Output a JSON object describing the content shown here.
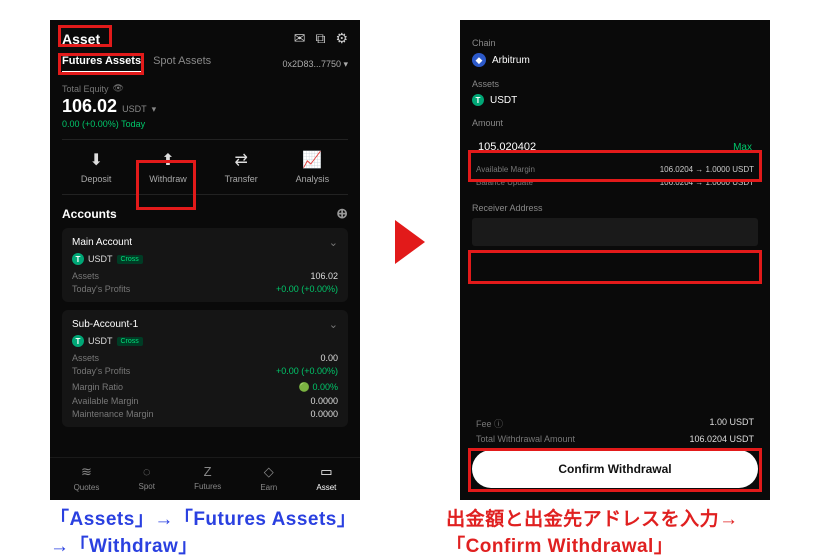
{
  "phone1": {
    "header_title": "Asset",
    "tabs": {
      "futures": "Futures Assets",
      "spot": "Spot Assets"
    },
    "address": "0x2D83...7750 ▾",
    "equity": {
      "label": "Total Equity",
      "value": "106.02",
      "currency": "USDT",
      "today": "0.00 (+0.00%) Today"
    },
    "actions": {
      "deposit": "Deposit",
      "withdraw": "Withdraw",
      "transfer": "Transfer",
      "analysis": "Analysis"
    },
    "accounts_label": "Accounts",
    "main_account": {
      "title": "Main Account",
      "coin": "USDT",
      "mode": "Cross",
      "assets_label": "Assets",
      "assets_value": "106.02",
      "profits_label": "Today's Profits",
      "profits_value": "+0.00  (+0.00%)"
    },
    "sub_account": {
      "title": "Sub-Account-1",
      "coin": "USDT",
      "mode": "Cross",
      "assets_label": "Assets",
      "assets_value": "0.00",
      "profits_label": "Today's Profits",
      "profits_value": "+0.00  (+0.00%)",
      "margin_ratio_label": "Margin Ratio",
      "margin_ratio_value": "0.00%",
      "avail_label": "Available Margin",
      "avail_value": "0.0000",
      "maint_label": "Maintenance Margin",
      "maint_value": "0.0000"
    },
    "nav": {
      "quotes": "Quotes",
      "spot": "Spot",
      "futures": "Futures",
      "earn": "Earn",
      "asset": "Asset"
    }
  },
  "phone2": {
    "chain_label": "Chain",
    "chain_value": "Arbitrum",
    "assets_label": "Assets",
    "assets_value": "USDT",
    "amount_label": "Amount",
    "amount_value": "105.020402",
    "max": "Max",
    "avail_margin_label": "Available Margin",
    "avail_margin_value": "106.0204 → 1.0000 USDT",
    "balance_label": "Balance Update",
    "balance_value": "106.0204 → 1.0000 USDT",
    "receiver_label": "Receiver Address",
    "fee_label": "Fee",
    "fee_value": "1.00 USDT",
    "total_label": "Total Withdrawal Amount",
    "total_value": "106.0204 USDT",
    "confirm": "Confirm Withdrawal"
  },
  "captions": {
    "left": "「Assets」→「Futures Assets」→「Withdraw」",
    "right": "出金額と出金先アドレスを入力→「Confirm Withdrawal」"
  }
}
